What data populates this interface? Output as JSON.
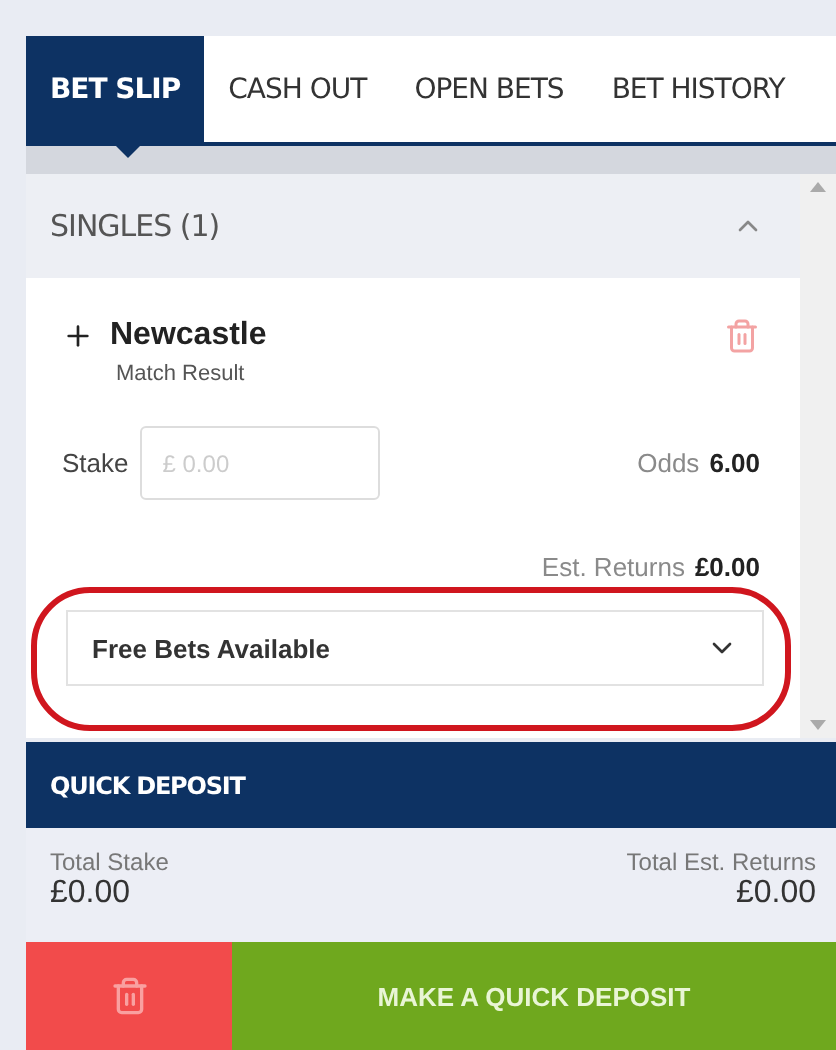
{
  "tabs": [
    {
      "label": "BET SLIP",
      "selected": true
    },
    {
      "label": "CASH OUT",
      "selected": false
    },
    {
      "label": "OPEN BETS",
      "selected": false
    },
    {
      "label": "BET HISTORY",
      "selected": false
    }
  ],
  "section": {
    "title": "SINGLES (1)",
    "expanded": true
  },
  "bet": {
    "selection": "Newcastle",
    "market": "Match Result",
    "stake_label": "Stake",
    "stake_placeholder": "£ 0.00",
    "odds_label": "Odds",
    "odds": "6.00",
    "returns_label": "Est. Returns",
    "returns": "£0.00",
    "free_bets": "Free Bets Available",
    "highlighted": true
  },
  "quick_deposit": {
    "title": "QUICK DEPOSIT"
  },
  "totals": {
    "stake_label": "Total Stake",
    "stake": "£0.00",
    "returns_label": "Total Est. Returns",
    "returns": "£0.00"
  },
  "deposit_button": "MAKE A QUICK DEPOSIT"
}
